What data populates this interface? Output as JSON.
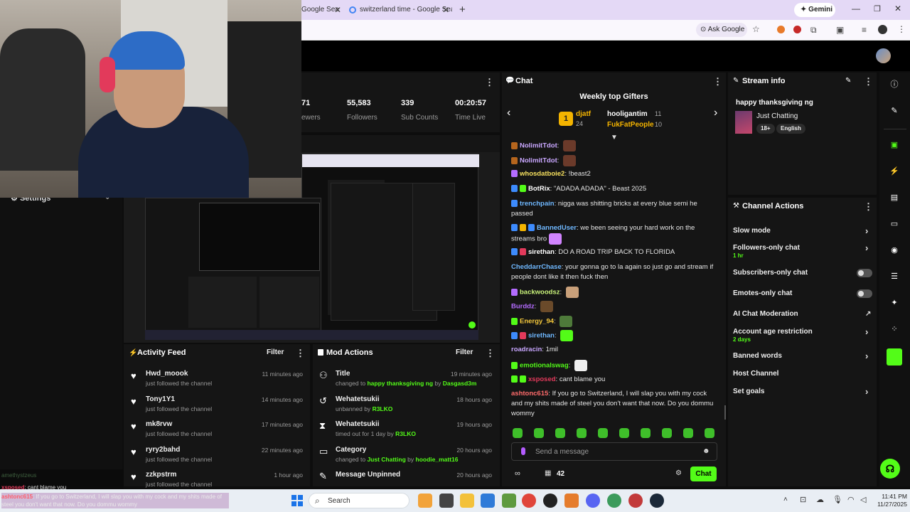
{
  "browser": {
    "tabs": [
      {
        "title": "Google Sea"
      },
      {
        "title": "switzerland time - Google Sear"
      }
    ],
    "gemini_label": "Gemini",
    "ask_google": "Ask Google"
  },
  "stats": {
    "partial_value": "71",
    "partial_label": "ewers",
    "followers_value": "55,583",
    "followers_label": "Followers",
    "subs_value": "339",
    "subs_label": "Sub Counts",
    "time_value": "00:20:57",
    "time_label": "Time Live"
  },
  "left_sidebar": {
    "settings_label": "Settings"
  },
  "activity_feed": {
    "title": "Activity Feed",
    "filter": "Filter",
    "items": [
      {
        "name": "Hwd_moook",
        "sub": "just followed the channel",
        "time": "11 minutes ago"
      },
      {
        "name": "Tony1Y1",
        "sub": "just followed the channel",
        "time": "14 minutes ago"
      },
      {
        "name": "mk8rvw",
        "sub": "just followed the channel",
        "time": "17 minutes ago"
      },
      {
        "name": "ryry2bahd",
        "sub": "just followed the channel",
        "time": "22 minutes ago"
      },
      {
        "name": "zzkpstrm",
        "sub": "just followed the channel",
        "time": "1 hour ago"
      }
    ]
  },
  "mod_actions": {
    "title": "Mod Actions",
    "filter": "Filter",
    "items": [
      {
        "title": "Title",
        "pre": "changed to",
        "target": "happy thanksgiving ng",
        "by": "by",
        "user": "Dasgasd3m",
        "time": "19 minutes ago"
      },
      {
        "title": "Wehatetsukii",
        "pre": "unbanned",
        "target": "",
        "by": "by",
        "user": "R3LKO",
        "time": "18 hours ago"
      },
      {
        "title": "Wehatetsukii",
        "pre": "timed out for 1 day",
        "target": "",
        "by": "by",
        "user": "R3LKO",
        "time": "19 hours ago"
      },
      {
        "title": "Category",
        "pre": "changed to",
        "target": "Just Chatting",
        "by": "by",
        "user": "hoodie_matt16",
        "time": "20 hours ago"
      },
      {
        "title": "Message Unpinned",
        "pre": "",
        "target": "",
        "by": "",
        "user": "",
        "time": "20 hours ago"
      }
    ]
  },
  "chat": {
    "title": "Chat",
    "gifters_title": "Weekly top Gifters",
    "gifters": [
      {
        "name": "djatf",
        "count": "24"
      },
      {
        "name": "hooligantim",
        "count": "11"
      },
      {
        "name": "FukFatPeople",
        "count": "10"
      }
    ],
    "messages": [
      {
        "user": "NolimitTdot",
        "text": ""
      },
      {
        "user": "NolimitTdot",
        "text": ""
      },
      {
        "user": "whosdatboie2",
        "text": "!beast2"
      },
      {
        "user": "BotRix",
        "text": "\"ADADA ADADA\" - Beast 2025"
      },
      {
        "user": "trenchpain",
        "text": "nigga was shitting bricks at every blue semi he passed"
      },
      {
        "user": "BannedUser",
        "text": "we been seeing your hard work on the streams bro"
      },
      {
        "user": "sirethan",
        "text": "DO A ROAD TRIP BACK TO FLORIDA"
      },
      {
        "user": "CheddarrChase",
        "text": "your gonna go to la again so just go and stream if people dont like it then fuck then"
      },
      {
        "user": "backwoodsz",
        "text": ""
      },
      {
        "user": "Burddz",
        "text": ""
      },
      {
        "user": "Energy_94",
        "text": ""
      },
      {
        "user": "sirethan",
        "text": ""
      },
      {
        "user": "roadracin",
        "text": "1mil"
      },
      {
        "user": "emotionalswag",
        "text": ""
      },
      {
        "user": "xsposed",
        "text": "cant blame you"
      },
      {
        "user": "ashtonc615",
        "text": "If you go to Switzerland, I will slap you with my cock and my shits made of steel you don't want that now. Do you dommu wommy"
      }
    ],
    "input_placeholder": "Send a message",
    "viewer_count": "42",
    "send_label": "Chat"
  },
  "stream_info": {
    "title": "Stream info",
    "stream_title": "happy thanksgiving ng",
    "category": "Just Chatting",
    "tag_age": "18+",
    "tag_lang": "English"
  },
  "channel_actions": {
    "title": "Channel Actions",
    "items": [
      {
        "label": "Slow mode",
        "sub": "",
        "control": "chevron"
      },
      {
        "label": "Followers-only chat",
        "sub": "1 hr",
        "control": "chevron"
      },
      {
        "label": "Subscribers-only chat",
        "sub": "",
        "control": "toggle"
      },
      {
        "label": "Emotes-only chat",
        "sub": "",
        "control": "toggle"
      },
      {
        "label": "AI Chat Moderation",
        "sub": "",
        "control": "external"
      },
      {
        "label": "Account age restriction",
        "sub": "2 days",
        "control": "chevron"
      },
      {
        "label": "Banned words",
        "sub": "",
        "control": "chevron"
      },
      {
        "label": "Host Channel",
        "sub": "",
        "control": "none"
      },
      {
        "label": "Set goals",
        "sub": "",
        "control": "chevron"
      }
    ]
  },
  "overlay_chat": {
    "user1": "amethystzeus",
    "user2": "xsposed",
    "text2": "cant blame you",
    "user3": "ashtonc615",
    "text3": "If you go to Switzerland, I will slap you with my cock and my shits made of steel you don't want that now. Do you dommu wommy"
  },
  "taskbar": {
    "search_label": "Search",
    "time": "11:41 PM",
    "date": "11/27/2025"
  },
  "colors": {
    "accent": "#53fc18",
    "panel": "#151515",
    "bg": "#0d0d0d",
    "tab_bar": "#e4d9f6"
  }
}
